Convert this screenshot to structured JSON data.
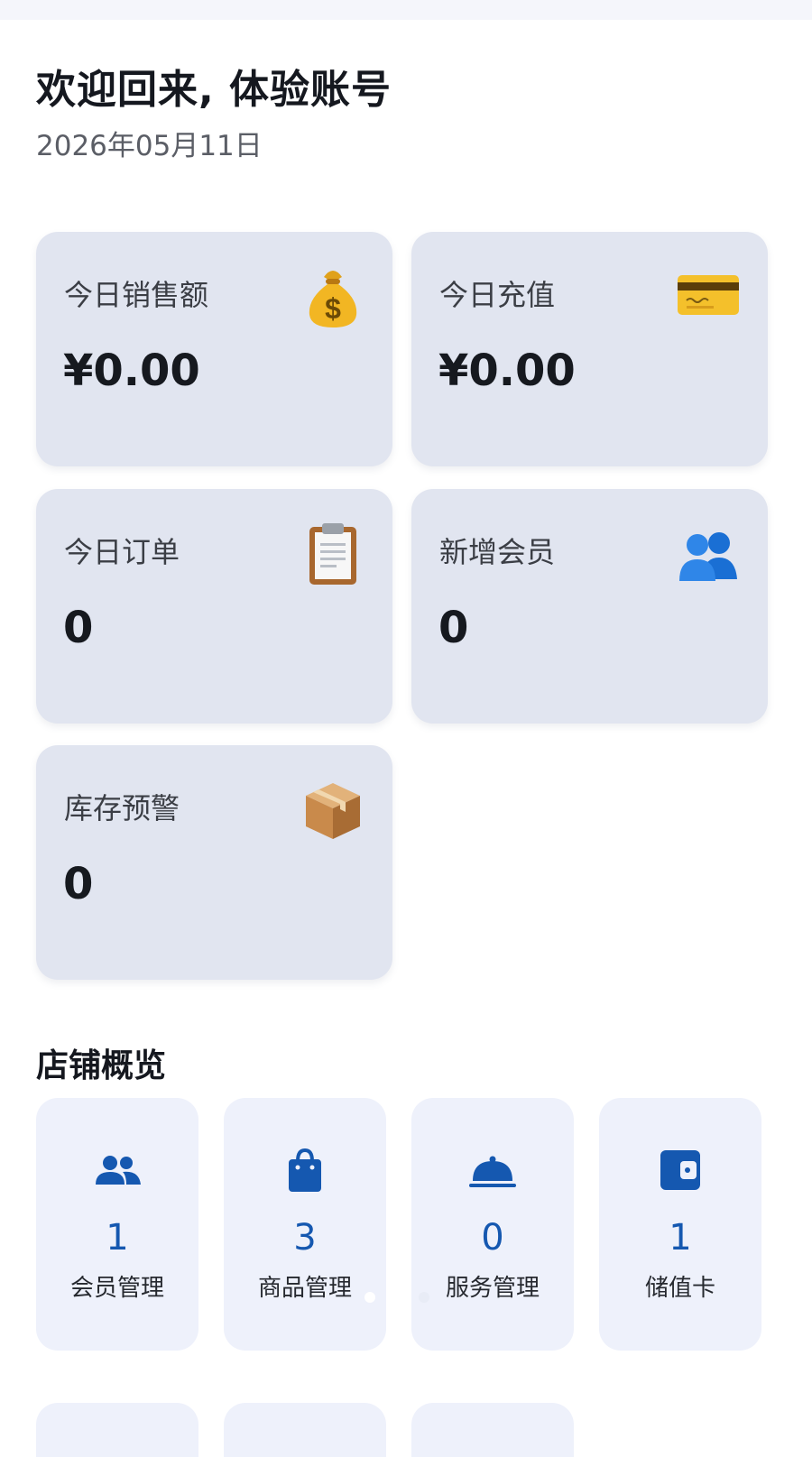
{
  "header": {
    "welcome": "欢迎回来, 体验账号",
    "date": "2026年05月11日"
  },
  "stats": [
    {
      "label": "今日销售额",
      "value": "¥0.00",
      "icon": "money-bag-icon"
    },
    {
      "label": "今日充值",
      "value": "¥0.00",
      "icon": "credit-card-icon"
    },
    {
      "label": "今日订单",
      "value": "0",
      "icon": "clipboard-icon"
    },
    {
      "label": "新增会员",
      "value": "0",
      "icon": "members-icon"
    },
    {
      "label": "库存预警",
      "value": "0",
      "icon": "package-icon"
    }
  ],
  "overview": {
    "title": "店铺概览",
    "tiles": [
      {
        "count": "1",
        "label": "会员管理",
        "icon": "people-icon"
      },
      {
        "count": "3",
        "label": "商品管理",
        "icon": "shopping-bag-icon"
      },
      {
        "count": "0",
        "label": "服务管理",
        "icon": "service-bell-icon"
      },
      {
        "count": "1",
        "label": "储值卡",
        "icon": "wallet-icon"
      }
    ]
  },
  "colors": {
    "accent": "#1558b0",
    "card_bg": "#e1e5f0",
    "tile_bg": "#eef1fb"
  }
}
